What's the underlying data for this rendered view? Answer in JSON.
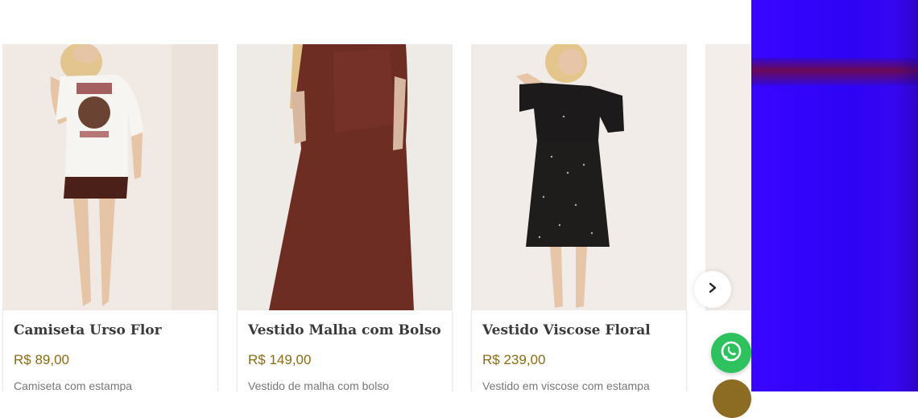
{
  "products": [
    {
      "title": "Camiseta Urso Flor",
      "price": "R$ 89,00",
      "description": "Camiseta com estampa"
    },
    {
      "title": "Vestido Malha com Bolso",
      "price": "R$ 149,00",
      "description": "Vestido de malha com bolso"
    },
    {
      "title": "Vestido Viscose Floral",
      "price": "R$ 239,00",
      "description": "Vestido em viscose com estampa"
    }
  ],
  "icons": {
    "next": "chevron-right-icon",
    "whatsapp": "whatsapp-icon"
  },
  "colors": {
    "price": "#8a6a14",
    "whatsapp": "#2ec25f",
    "side_panel": "#3a05ff",
    "scroll_button": "#8c6b22"
  }
}
